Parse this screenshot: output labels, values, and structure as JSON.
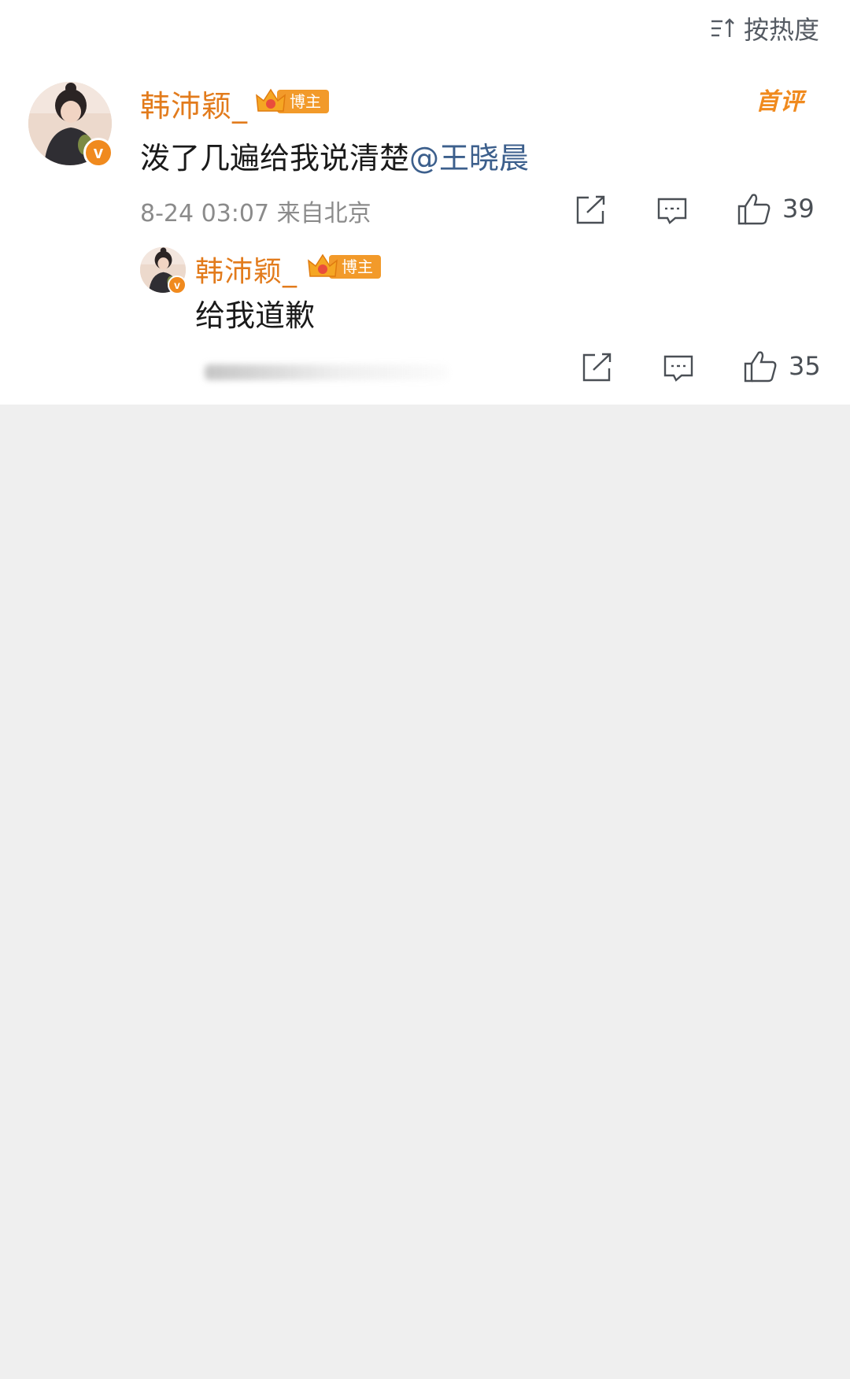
{
  "sort": {
    "icon": "sort-icon",
    "label": "按热度"
  },
  "comment": {
    "username": "韩沛颖_",
    "badge": "博主",
    "first_tag": "首评",
    "text": "泼了几遍给我说清楚",
    "mention": "@王晓晨",
    "time": "8-24 03:07",
    "location": "来自北京",
    "likes": "39",
    "verified_mark": "v"
  },
  "reply": {
    "username": "韩沛颖_",
    "badge": "博主",
    "text": "给我道歉",
    "likes": "35",
    "verified_mark": "v"
  },
  "colors": {
    "username": "#e27b1c",
    "mention": "#3c5f8c",
    "badge": "#f29a2a",
    "background": "#efefef"
  }
}
